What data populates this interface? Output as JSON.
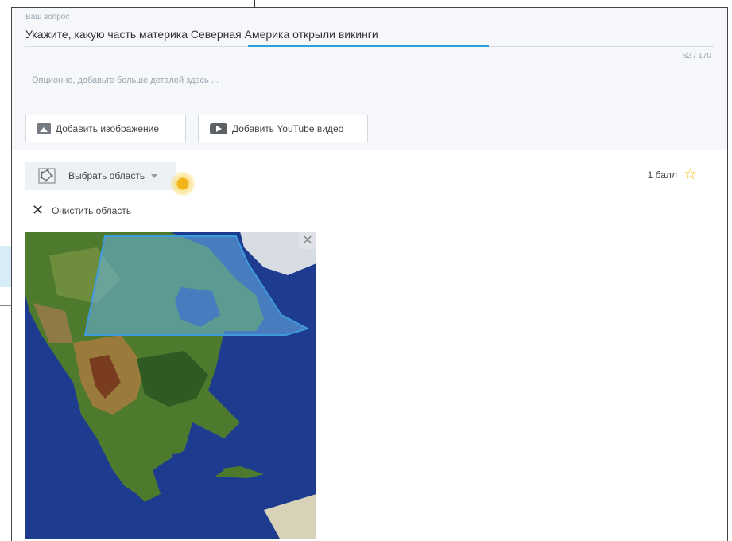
{
  "question": {
    "label": "Ваш вопрос",
    "text": "Укажите, какую часть материка Северная Америка открыли викинги",
    "counter": "62 / 170",
    "details_placeholder": "Опционно, добавьте больше деталей здесь ..."
  },
  "media": {
    "add_image_label": "Добавить изображение",
    "add_youtube_label": "Добавить YouTube видео"
  },
  "area": {
    "select_label": "Выбрать область",
    "clear_label": "Очистить область"
  },
  "score": {
    "value": "1 балл",
    "icon": "star-icon"
  },
  "colors": {
    "accent": "#2a9fd8",
    "star": "#f5c200",
    "highlight": "#6ab4e6"
  }
}
